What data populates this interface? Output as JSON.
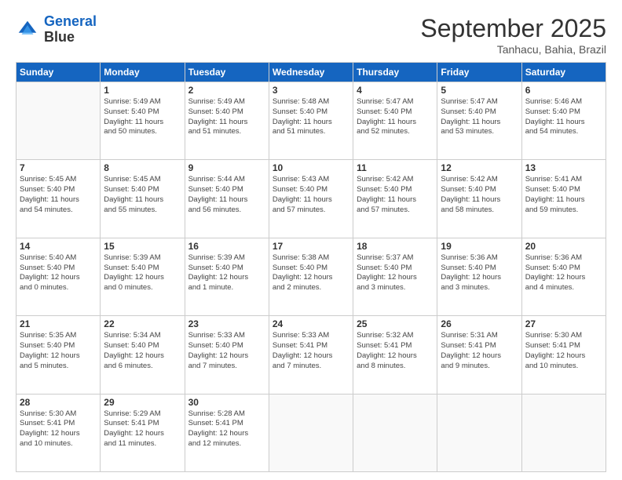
{
  "logo": {
    "line1": "General",
    "line2": "Blue"
  },
  "title": "September 2025",
  "subtitle": "Tanhacu, Bahia, Brazil",
  "days_header": [
    "Sunday",
    "Monday",
    "Tuesday",
    "Wednesday",
    "Thursday",
    "Friday",
    "Saturday"
  ],
  "weeks": [
    [
      {
        "day": "",
        "info": ""
      },
      {
        "day": "1",
        "info": "Sunrise: 5:49 AM\nSunset: 5:40 PM\nDaylight: 11 hours\nand 50 minutes."
      },
      {
        "day": "2",
        "info": "Sunrise: 5:49 AM\nSunset: 5:40 PM\nDaylight: 11 hours\nand 51 minutes."
      },
      {
        "day": "3",
        "info": "Sunrise: 5:48 AM\nSunset: 5:40 PM\nDaylight: 11 hours\nand 51 minutes."
      },
      {
        "day": "4",
        "info": "Sunrise: 5:47 AM\nSunset: 5:40 PM\nDaylight: 11 hours\nand 52 minutes."
      },
      {
        "day": "5",
        "info": "Sunrise: 5:47 AM\nSunset: 5:40 PM\nDaylight: 11 hours\nand 53 minutes."
      },
      {
        "day": "6",
        "info": "Sunrise: 5:46 AM\nSunset: 5:40 PM\nDaylight: 11 hours\nand 54 minutes."
      }
    ],
    [
      {
        "day": "7",
        "info": "Sunrise: 5:45 AM\nSunset: 5:40 PM\nDaylight: 11 hours\nand 54 minutes."
      },
      {
        "day": "8",
        "info": "Sunrise: 5:45 AM\nSunset: 5:40 PM\nDaylight: 11 hours\nand 55 minutes."
      },
      {
        "day": "9",
        "info": "Sunrise: 5:44 AM\nSunset: 5:40 PM\nDaylight: 11 hours\nand 56 minutes."
      },
      {
        "day": "10",
        "info": "Sunrise: 5:43 AM\nSunset: 5:40 PM\nDaylight: 11 hours\nand 57 minutes."
      },
      {
        "day": "11",
        "info": "Sunrise: 5:42 AM\nSunset: 5:40 PM\nDaylight: 11 hours\nand 57 minutes."
      },
      {
        "day": "12",
        "info": "Sunrise: 5:42 AM\nSunset: 5:40 PM\nDaylight: 11 hours\nand 58 minutes."
      },
      {
        "day": "13",
        "info": "Sunrise: 5:41 AM\nSunset: 5:40 PM\nDaylight: 11 hours\nand 59 minutes."
      }
    ],
    [
      {
        "day": "14",
        "info": "Sunrise: 5:40 AM\nSunset: 5:40 PM\nDaylight: 12 hours\nand 0 minutes."
      },
      {
        "day": "15",
        "info": "Sunrise: 5:39 AM\nSunset: 5:40 PM\nDaylight: 12 hours\nand 0 minutes."
      },
      {
        "day": "16",
        "info": "Sunrise: 5:39 AM\nSunset: 5:40 PM\nDaylight: 12 hours\nand 1 minute."
      },
      {
        "day": "17",
        "info": "Sunrise: 5:38 AM\nSunset: 5:40 PM\nDaylight: 12 hours\nand 2 minutes."
      },
      {
        "day": "18",
        "info": "Sunrise: 5:37 AM\nSunset: 5:40 PM\nDaylight: 12 hours\nand 3 minutes."
      },
      {
        "day": "19",
        "info": "Sunrise: 5:36 AM\nSunset: 5:40 PM\nDaylight: 12 hours\nand 3 minutes."
      },
      {
        "day": "20",
        "info": "Sunrise: 5:36 AM\nSunset: 5:40 PM\nDaylight: 12 hours\nand 4 minutes."
      }
    ],
    [
      {
        "day": "21",
        "info": "Sunrise: 5:35 AM\nSunset: 5:40 PM\nDaylight: 12 hours\nand 5 minutes."
      },
      {
        "day": "22",
        "info": "Sunrise: 5:34 AM\nSunset: 5:40 PM\nDaylight: 12 hours\nand 6 minutes."
      },
      {
        "day": "23",
        "info": "Sunrise: 5:33 AM\nSunset: 5:40 PM\nDaylight: 12 hours\nand 7 minutes."
      },
      {
        "day": "24",
        "info": "Sunrise: 5:33 AM\nSunset: 5:41 PM\nDaylight: 12 hours\nand 7 minutes."
      },
      {
        "day": "25",
        "info": "Sunrise: 5:32 AM\nSunset: 5:41 PM\nDaylight: 12 hours\nand 8 minutes."
      },
      {
        "day": "26",
        "info": "Sunrise: 5:31 AM\nSunset: 5:41 PM\nDaylight: 12 hours\nand 9 minutes."
      },
      {
        "day": "27",
        "info": "Sunrise: 5:30 AM\nSunset: 5:41 PM\nDaylight: 12 hours\nand 10 minutes."
      }
    ],
    [
      {
        "day": "28",
        "info": "Sunrise: 5:30 AM\nSunset: 5:41 PM\nDaylight: 12 hours\nand 10 minutes."
      },
      {
        "day": "29",
        "info": "Sunrise: 5:29 AM\nSunset: 5:41 PM\nDaylight: 12 hours\nand 11 minutes."
      },
      {
        "day": "30",
        "info": "Sunrise: 5:28 AM\nSunset: 5:41 PM\nDaylight: 12 hours\nand 12 minutes."
      },
      {
        "day": "",
        "info": ""
      },
      {
        "day": "",
        "info": ""
      },
      {
        "day": "",
        "info": ""
      },
      {
        "day": "",
        "info": ""
      }
    ]
  ]
}
